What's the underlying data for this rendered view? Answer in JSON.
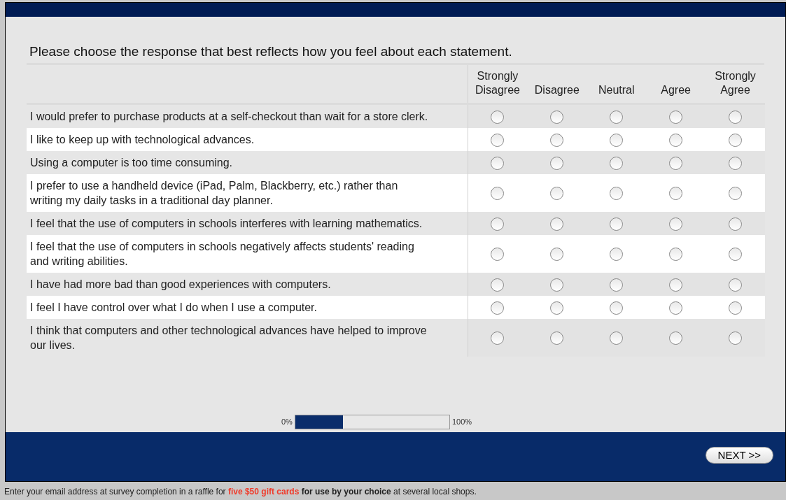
{
  "instructions": "Please choose the response that best reflects how you feel about each statement.",
  "columns": [
    "Strongly Disagree",
    "Disagree",
    "Neutral",
    "Agree",
    "Strongly Agree"
  ],
  "rows": [
    {
      "statement": "I would prefer to purchase products at a self-checkout than wait for a store clerk.",
      "responses": [
        {
          "selected": false
        },
        {
          "selected": false
        },
        {
          "selected": false
        },
        {
          "selected": false
        },
        {
          "selected": false
        }
      ]
    },
    {
      "statement": "I like to keep up with technological advances.",
      "responses": [
        {
          "selected": false
        },
        {
          "selected": false
        },
        {
          "selected": false
        },
        {
          "selected": false
        },
        {
          "selected": false
        }
      ]
    },
    {
      "statement": "Using a computer is too time consuming.",
      "responses": [
        {
          "selected": false
        },
        {
          "selected": false
        },
        {
          "selected": false
        },
        {
          "selected": false
        },
        {
          "selected": false
        }
      ]
    },
    {
      "statement": "I prefer to use a handheld device (iPad, Palm, Blackberry, etc.) rather than writing my daily tasks in a traditional day planner.",
      "responses": [
        {
          "selected": false
        },
        {
          "selected": false
        },
        {
          "selected": false
        },
        {
          "selected": false
        },
        {
          "selected": false
        }
      ]
    },
    {
      "statement": "I feel that the use of computers in schools interferes with learning mathematics.",
      "responses": [
        {
          "selected": false
        },
        {
          "selected": false
        },
        {
          "selected": false
        },
        {
          "selected": false
        },
        {
          "selected": false
        }
      ]
    },
    {
      "statement": "I feel that the use of computers in schools negatively affects students' reading and writing abilities.",
      "responses": [
        {
          "selected": false
        },
        {
          "selected": false
        },
        {
          "selected": false
        },
        {
          "selected": false
        },
        {
          "selected": false
        }
      ]
    },
    {
      "statement": "I have had more bad than good experiences with computers.",
      "responses": [
        {
          "selected": false
        },
        {
          "selected": false
        },
        {
          "selected": false
        },
        {
          "selected": false
        },
        {
          "selected": false
        }
      ]
    },
    {
      "statement": "I feel I have control over what I do when I use a computer.",
      "responses": [
        {
          "selected": false
        },
        {
          "selected": false
        },
        {
          "selected": false
        },
        {
          "selected": false
        },
        {
          "selected": false
        }
      ]
    },
    {
      "statement": "I think that computers and other technological advances have helped to improve our lives.",
      "responses": [
        {
          "selected": false
        },
        {
          "selected": false
        },
        {
          "selected": false
        },
        {
          "selected": false
        },
        {
          "selected": false
        }
      ]
    }
  ],
  "progress": {
    "min_label": "0%",
    "max_label": "100%",
    "level": 0.31
  },
  "next_button": "NEXT >>",
  "footer_note": [
    {
      "kind": "plain",
      "text": "Enter your email address at survey completion in a raffle for "
    },
    {
      "kind": "highlight",
      "text": "five $50 gift cards"
    },
    {
      "kind": "bold",
      "text": " for use by your choice"
    },
    {
      "kind": "plain",
      "text": " at several local shops."
    }
  ]
}
